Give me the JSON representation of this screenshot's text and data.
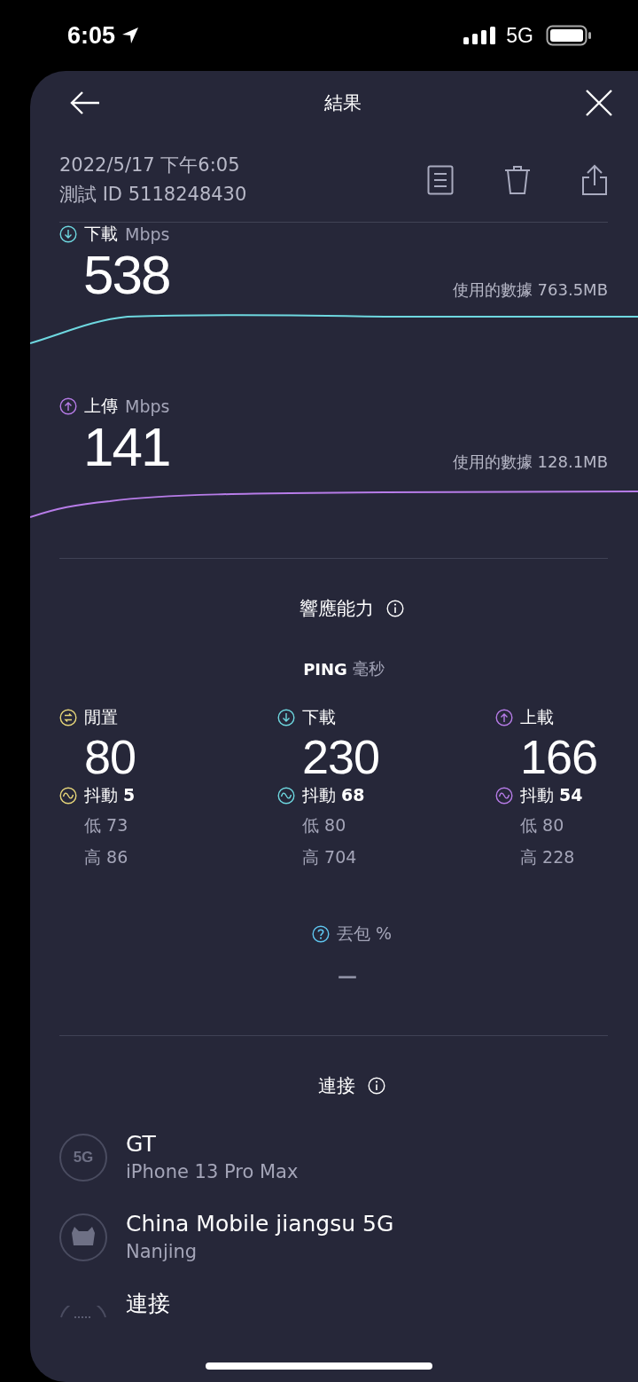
{
  "status_bar": {
    "time": "6:05",
    "network": "5G"
  },
  "header": {
    "title": "結果"
  },
  "test": {
    "date": "2022/5/17 下午6:05",
    "test_id": "測試 ID 5118248430"
  },
  "speeds": [
    {
      "kind": "download",
      "label": "下載",
      "unit": "Mbps",
      "value": "538",
      "data_used": "使用的數據 763.5MB",
      "color": "#6ed8e0"
    },
    {
      "kind": "upload",
      "label": "上傳",
      "unit": "Mbps",
      "value": "141",
      "data_used": "使用的數據 128.1MB",
      "color": "#b77ce8"
    }
  ],
  "responsiveness": {
    "title": "響應能力",
    "ping_label": "PING",
    "ping_unit": "毫秒",
    "columns": [
      {
        "kind": "idle",
        "label": "閒置",
        "value": "80",
        "jitter": "抖動 **5**",
        "low": "低 73",
        "high": "高 86",
        "color": "#e8d77a"
      },
      {
        "kind": "download",
        "label": "下載",
        "value": "230",
        "jitter": "抖動 **68**",
        "low": "低 80",
        "high": "高 704",
        "color": "#6ed8e0"
      },
      {
        "kind": "upload",
        "label": "上載",
        "value": "166",
        "jitter": "抖動 **54**",
        "low": "低 80",
        "high": "高 228",
        "color": "#b77ce8"
      }
    ],
    "packet_loss": {
      "label": "丟包 %",
      "value": "—"
    }
  },
  "connections": {
    "title": "連接",
    "items": [
      {
        "kind": "network",
        "icon_text": "5G",
        "title": "GT",
        "subtitle": "iPhone 13 Pro Max"
      },
      {
        "kind": "server",
        "title": "China Mobile jiangsu 5G",
        "subtitle": "Nanjing"
      },
      {
        "kind": "connection",
        "title": "連接"
      }
    ]
  }
}
